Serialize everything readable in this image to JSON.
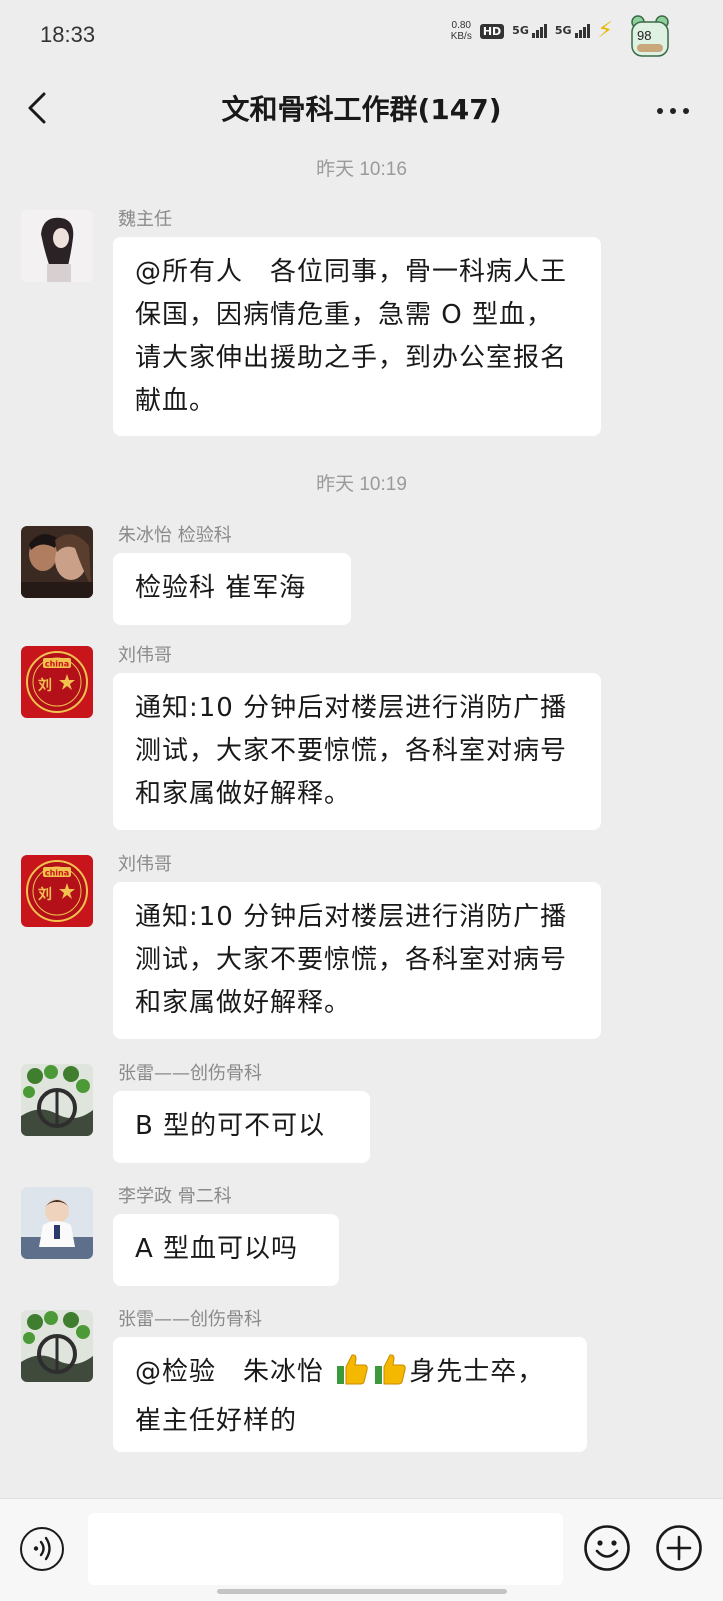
{
  "status": {
    "time": "18:33",
    "net_speed_value": "0.80",
    "net_speed_unit": "KB/s",
    "hd": "HD",
    "sim1": "5G",
    "sim2": "5G",
    "battery": "98"
  },
  "header": {
    "title": "文和骨科工作群(147)"
  },
  "messages": [
    {
      "type": "time",
      "text": "昨天 10:16"
    },
    {
      "type": "msg",
      "sender": "魏主任",
      "text": "@所有人　各位同事，骨一科病人王保国，因病情危重，急需 O 型血，请大家伸出援助之手，到办公室报名献血。"
    },
    {
      "type": "time",
      "text": "昨天 10:19"
    },
    {
      "type": "msg",
      "sender": "朱冰怡 检验科",
      "text": "检验科 崔军海"
    },
    {
      "type": "msg",
      "sender": "刘伟哥",
      "text": "通知:10 分钟后对楼层进行消防广播测试，大家不要惊慌，各科室对病号和家属做好解释。"
    },
    {
      "type": "msg",
      "sender": "刘伟哥",
      "text": "通知:10 分钟后对楼层进行消防广播测试，大家不要惊慌，各科室对病号和家属做好解释。"
    },
    {
      "type": "msg",
      "sender": "张雷——创伤骨科",
      "text": "B 型的可不可以"
    },
    {
      "type": "msg",
      "sender": "李学政 骨二科",
      "text": "A 型血可以吗"
    },
    {
      "type": "msg",
      "sender": "张雷——创伤骨科",
      "text_before": "@检验　朱冰怡 ",
      "text_after": "身先士卒，崔主任好样的",
      "emoji": [
        "thumbs-up",
        "thumbs-up"
      ]
    }
  ],
  "avatars": {
    "liu_text": "刘",
    "liu_badge": "china"
  },
  "colors": {
    "background": "#ededed",
    "bubble": "#ffffff",
    "meta_text": "#9a9a9a",
    "thumb": "#f5b800",
    "flag_red": "#c8151b"
  },
  "icons": [
    "back-arrow-icon",
    "more-icon",
    "voice-icon",
    "emoji-icon",
    "plus-icon"
  ]
}
